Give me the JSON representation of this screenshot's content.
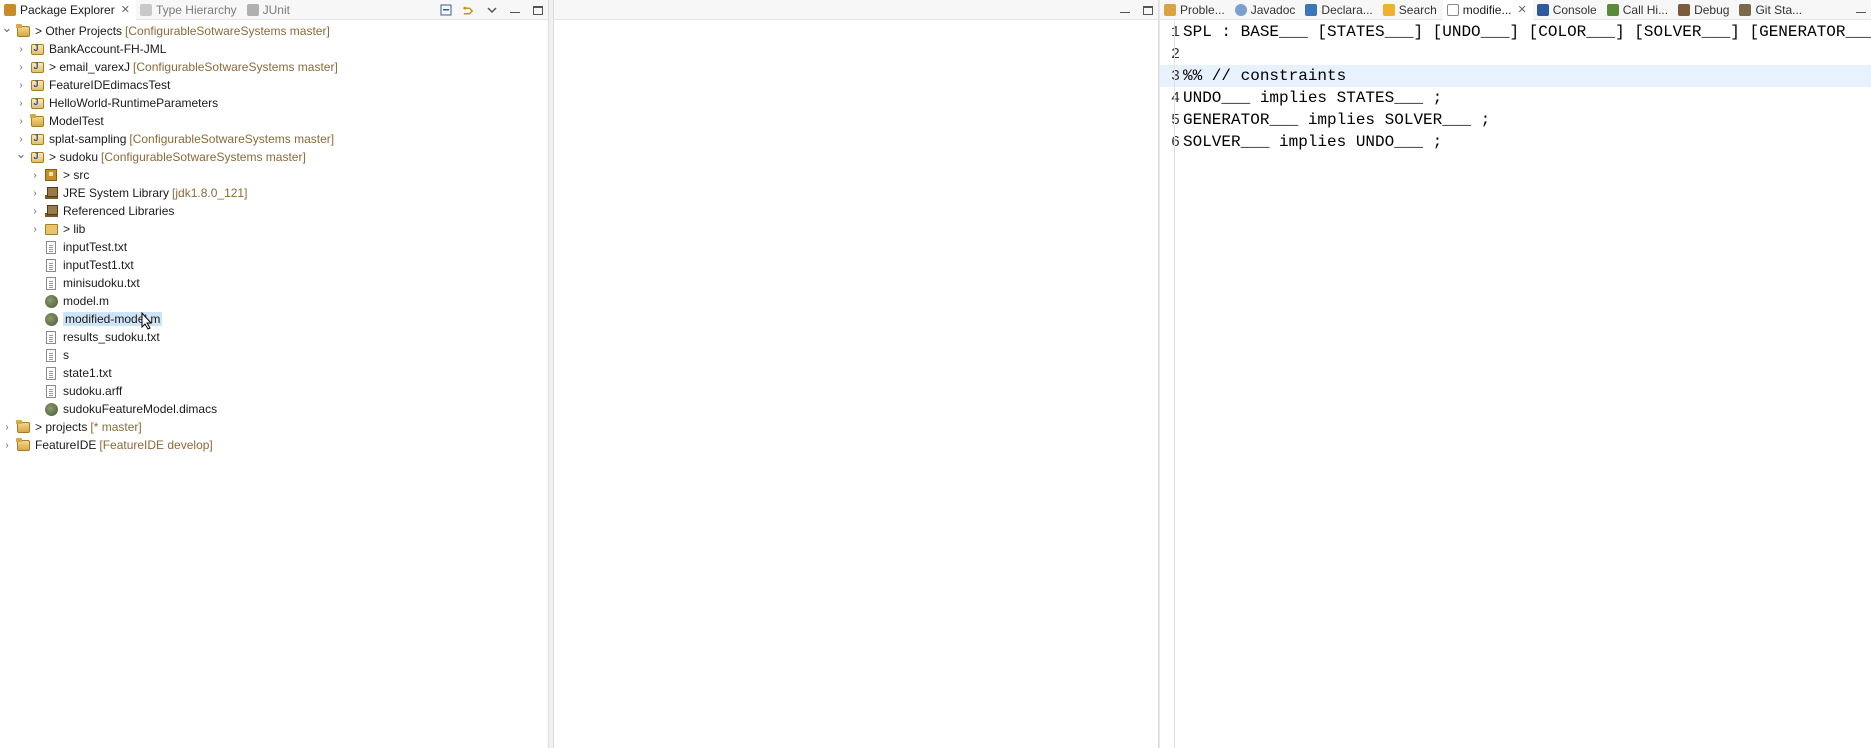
{
  "package_explorer": {
    "tabs": [
      {
        "label": "Package Explorer",
        "active": true,
        "icon": "package-icon",
        "close": "✕"
      },
      {
        "label": "Type Hierarchy",
        "active": false,
        "icon": "hierarchy-icon"
      },
      {
        "label": "JUnit",
        "active": false,
        "icon": "junit-icon"
      }
    ],
    "tree": [
      {
        "depth": 0,
        "twisty": "expanded",
        "icon": "project-icon",
        "label": "> Other Projects",
        "deco": "[ConfigurableSotwareSystems master]"
      },
      {
        "depth": 1,
        "twisty": "collapsed",
        "icon": "java-project-icon",
        "label": "BankAccount-FH-JML",
        "deco": ""
      },
      {
        "depth": 1,
        "twisty": "collapsed",
        "icon": "java-project-icon",
        "label": "> email_varexJ",
        "deco": "[ConfigurableSotwareSystems master]"
      },
      {
        "depth": 1,
        "twisty": "collapsed",
        "icon": "java-project-icon",
        "label": "FeatureIDEdimacsTest",
        "deco": ""
      },
      {
        "depth": 1,
        "twisty": "collapsed",
        "icon": "java-project-icon",
        "label": "HelloWorld-RuntimeParameters",
        "deco": ""
      },
      {
        "depth": 1,
        "twisty": "collapsed",
        "icon": "project-icon",
        "label": "ModelTest",
        "deco": ""
      },
      {
        "depth": 1,
        "twisty": "collapsed",
        "icon": "java-project-icon",
        "label": "splat-sampling",
        "deco": "[ConfigurableSotwareSystems master]"
      },
      {
        "depth": 1,
        "twisty": "expanded",
        "icon": "java-project-icon",
        "label": "> sudoku",
        "deco": "[ConfigurableSotwareSystems master]"
      },
      {
        "depth": 2,
        "twisty": "collapsed",
        "icon": "source-folder-icon",
        "label": "> src",
        "deco": ""
      },
      {
        "depth": 2,
        "twisty": "collapsed",
        "icon": "library-icon",
        "label": "JRE System Library",
        "deco": "[jdk1.8.0_121]"
      },
      {
        "depth": 2,
        "twisty": "collapsed",
        "icon": "library-icon",
        "label": "Referenced Libraries",
        "deco": ""
      },
      {
        "depth": 2,
        "twisty": "collapsed",
        "icon": "folder-icon",
        "label": "> lib",
        "deco": ""
      },
      {
        "depth": 2,
        "twisty": "none",
        "icon": "text-file-icon",
        "label": "inputTest.txt",
        "deco": ""
      },
      {
        "depth": 2,
        "twisty": "none",
        "icon": "text-file-icon",
        "label": "inputTest1.txt",
        "deco": ""
      },
      {
        "depth": 2,
        "twisty": "none",
        "icon": "text-file-icon",
        "label": "minisudoku.txt",
        "deco": ""
      },
      {
        "depth": 2,
        "twisty": "none",
        "icon": "feature-model-icon",
        "label": "model.m",
        "deco": ""
      },
      {
        "depth": 2,
        "twisty": "none",
        "icon": "feature-model-icon",
        "label": "modified-model.m",
        "deco": "",
        "selected": true
      },
      {
        "depth": 2,
        "twisty": "none",
        "icon": "text-file-icon",
        "label": "results_sudoku.txt",
        "deco": ""
      },
      {
        "depth": 2,
        "twisty": "none",
        "icon": "text-file-icon",
        "label": "s",
        "deco": ""
      },
      {
        "depth": 2,
        "twisty": "none",
        "icon": "text-file-icon",
        "label": "state1.txt",
        "deco": ""
      },
      {
        "depth": 2,
        "twisty": "none",
        "icon": "text-file-icon",
        "label": "sudoku.arff",
        "deco": ""
      },
      {
        "depth": 2,
        "twisty": "none",
        "icon": "feature-model-icon",
        "label": "sudokuFeatureModel.dimacs",
        "deco": ""
      },
      {
        "depth": 0,
        "twisty": "collapsed",
        "icon": "project-icon",
        "label": "> projects",
        "deco": "[* master]"
      },
      {
        "depth": 0,
        "twisty": "collapsed",
        "icon": "project-icon",
        "label": "FeatureIDE",
        "deco": "[FeatureIDE develop]"
      }
    ]
  },
  "editor_area": {
    "tabs": [
      {
        "label": "Proble...",
        "icon": "problems-icon",
        "cls": "ic-prob",
        "active": false
      },
      {
        "label": "Javadoc",
        "icon": "javadoc-icon",
        "cls": "ic-jdoc",
        "active": false
      },
      {
        "label": "Declara...",
        "icon": "declaration-icon",
        "cls": "ic-decl",
        "active": false
      },
      {
        "label": "Search",
        "icon": "search-icon",
        "cls": "ic-search",
        "active": false
      },
      {
        "label": "modifie...",
        "icon": "model-file-icon",
        "cls": "ic-mod",
        "active": true,
        "close": "✕"
      },
      {
        "label": "Console",
        "icon": "console-icon",
        "cls": "ic-console",
        "active": false
      },
      {
        "label": "Call Hi...",
        "icon": "call-hierarchy-icon",
        "cls": "ic-call",
        "active": false
      },
      {
        "label": "Debug",
        "icon": "debug-icon",
        "cls": "ic-debug",
        "active": false
      },
      {
        "label": "Git Sta...",
        "icon": "git-staging-icon",
        "cls": "ic-git",
        "active": false
      }
    ],
    "lines": [
      {
        "num": "1",
        "text": "SPL : BASE___ [STATES___] [UNDO___] [COLOR___] [SOLVER___] [GENERATOR___] ;",
        "highlight": false
      },
      {
        "num": "2",
        "text": "",
        "highlight": false
      },
      {
        "num": "3",
        "text": "%% // constraints",
        "highlight": true
      },
      {
        "num": "4",
        "text": "UNDO___ implies STATES___ ;",
        "highlight": false
      },
      {
        "num": "5",
        "text": "GENERATOR___ implies SOLVER___ ;",
        "highlight": false
      },
      {
        "num": "6",
        "text": "SOLVER___ implies UNDO___ ;",
        "highlight": false
      }
    ]
  }
}
